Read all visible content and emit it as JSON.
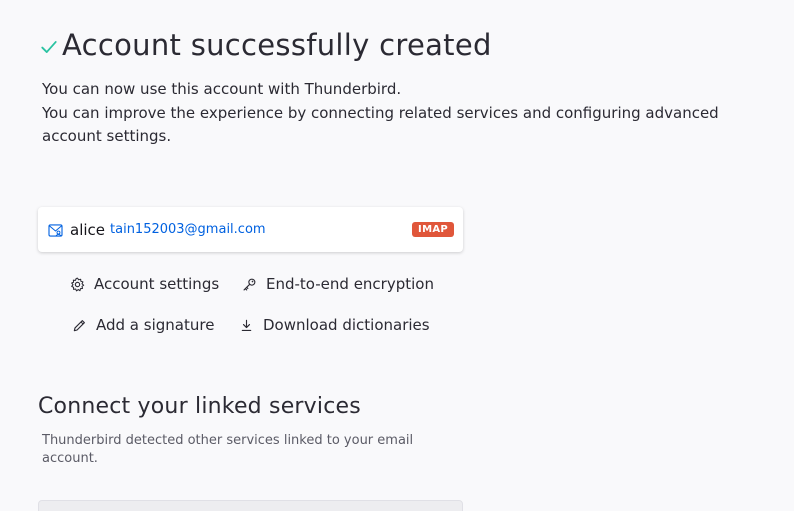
{
  "header": {
    "title": "Account successfully created",
    "icon": "check-icon"
  },
  "description": {
    "line1": "You can now use this account with Thunderbird.",
    "line2": "You can improve the experience by connecting related services and configuring advanced account settings."
  },
  "account": {
    "name": "alice",
    "email": "tain152003@gmail.com",
    "type_badge": "IMAP",
    "icon": "mail-account-icon"
  },
  "actions": {
    "account_settings": "Account settings",
    "encryption": "End-to-end encryption",
    "signature": "Add a signature",
    "dictionaries": "Download dictionaries"
  },
  "linked_services": {
    "title": "Connect your linked services",
    "description": "Thunderbird detected other services linked to your email account."
  },
  "colors": {
    "success": "#2ac3a2",
    "link": "#0061e0",
    "badge": "#e0563a"
  }
}
